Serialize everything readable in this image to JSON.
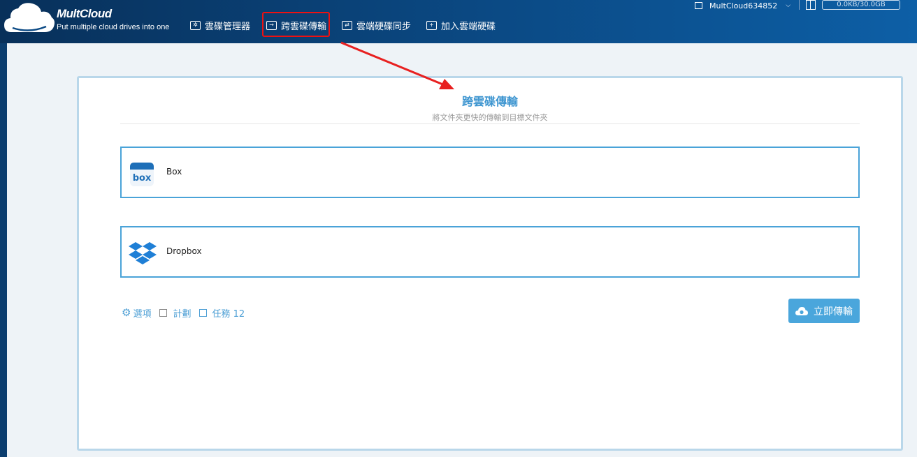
{
  "header": {
    "brand_name": "MultCloud",
    "tagline": "Put multiple cloud drives into one",
    "nav": [
      {
        "label": "雲碟管理器",
        "icon": "cloud-manager-icon"
      },
      {
        "label": "跨雲碟傳輸",
        "icon": "transfer-icon"
      },
      {
        "label": "雲端硬碟同步",
        "icon": "sync-icon"
      },
      {
        "label": "加入雲端硬碟",
        "icon": "add-icon"
      }
    ],
    "username": "MultCloud634852",
    "storage": "0.0KB/30.0GB"
  },
  "panel": {
    "title": "跨雲碟傳輸",
    "subtitle": "將文件夾更快的傳輸到目標文件夾",
    "source": {
      "label": "Box",
      "icon": "box-logo-icon"
    },
    "target": {
      "label": "Dropbox",
      "icon": "dropbox-logo-icon"
    },
    "options_label": "選項",
    "schedule_label": "計劃",
    "tasks_label": "任務 12",
    "transfer_button": "立即傳輸"
  },
  "colors": {
    "header_bg": "#0b4a85",
    "accent": "#3d95d0",
    "highlight_red": "#e11"
  }
}
